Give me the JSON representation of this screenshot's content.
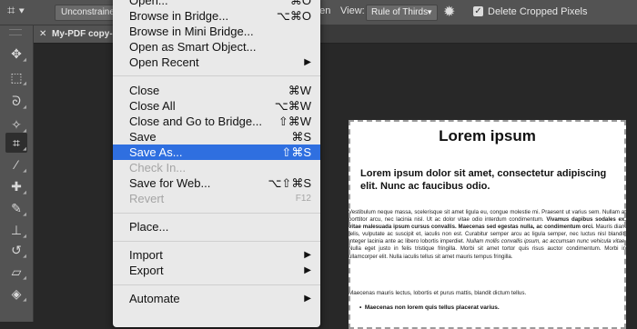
{
  "options_bar": {
    "crop_icon": "crop-icon",
    "ratio_label": "Unconstrained",
    "partial_label": "hten",
    "view_label": "View:",
    "view_value": "Rule of Thirds",
    "gear_icon": "gear-icon",
    "delete_checked": true,
    "delete_label": "Delete Cropped Pixels"
  },
  "tab": {
    "title": "My-PDF copy-",
    "close_icon": "close-icon"
  },
  "tools": [
    {
      "name": "move-tool-icon",
      "glyph": "✥"
    },
    {
      "name": "marquee-tool-icon",
      "glyph": "⬚"
    },
    {
      "name": "lasso-tool-icon",
      "glyph": "ᘐ"
    },
    {
      "name": "magic-wand-icon",
      "glyph": "✧"
    },
    {
      "name": "crop-tool-icon",
      "glyph": "⌗",
      "active": true
    },
    {
      "name": "eyedropper-icon",
      "glyph": "⁄"
    },
    {
      "name": "healing-brush-icon",
      "glyph": "✚"
    },
    {
      "name": "brush-tool-icon",
      "glyph": "✎"
    },
    {
      "name": "clone-stamp-icon",
      "glyph": "⊥"
    },
    {
      "name": "history-brush-icon",
      "glyph": "↺"
    },
    {
      "name": "eraser-tool-icon",
      "glyph": "▱"
    },
    {
      "name": "paint-bucket-icon",
      "glyph": "◈"
    }
  ],
  "menu": {
    "items": [
      {
        "label": "Open...",
        "shortcut": "⌘O"
      },
      {
        "label": "Browse in Bridge...",
        "shortcut": "⌥⌘O"
      },
      {
        "label": "Browse in Mini Bridge...",
        "shortcut": ""
      },
      {
        "label": "Open as Smart Object...",
        "shortcut": ""
      },
      {
        "label": "Open Recent",
        "submenu": true
      },
      {
        "label": "Close",
        "shortcut": "⌘W"
      },
      {
        "label": "Close All",
        "shortcut": "⌥⌘W"
      },
      {
        "label": "Close and Go to Bridge...",
        "shortcut": "⇧⌘W"
      },
      {
        "label": "Save",
        "shortcut": "⌘S"
      },
      {
        "label": "Save As...",
        "shortcut": "⇧⌘S",
        "selected": true
      },
      {
        "label": "Check In...",
        "disabled": true
      },
      {
        "label": "Save for Web...",
        "shortcut": "⌥⇧⌘S"
      },
      {
        "label": "Revert",
        "shortcut": "F12",
        "disabled": true
      },
      {
        "label": "Place..."
      },
      {
        "label": "Import",
        "submenu": true
      },
      {
        "label": "Export",
        "submenu": true
      },
      {
        "label": "Automate",
        "submenu": true
      }
    ]
  },
  "document": {
    "title": "Lorem ipsum",
    "subtitle": "Lorem ipsum dolor sit amet, consectetur adipiscing elit. Nunc ac faucibus odio.",
    "body_1": "Vestibulum neque massa, scelerisque sit amet ligula eu, congue molestie mi. Praesent ut varius sem. Nullam at porttitor arcu, nec lacinia nisl. Ut ac dolor vitae odio interdum condimentum. ",
    "body_bold": "Vivamus dapibus sodales ex, vitae malesuada ipsum cursus convallis. Maecenas sed egestas nulla, ac condimentum orci.",
    "body_2": " Mauris diam felis, vulputate ac suscipit et, iaculis non est. Curabitur semper arcu ac ligula semper, nec luctus nisl blandit. Integer lacinia ante ac libero lobortis imperdiet. ",
    "body_italic": "Nullam mollis convallis ipsum, ac accumsan nunc vehicula vitae.",
    "body_3": " Nulla eget justo in felis tristique fringilla. Morbi sit amet tortor quis risus auctor condimentum. Morbi in ullamcorper elit. Nulla iaculis tellus sit amet mauris tempus fringilla.",
    "para_2": "Maecenas mauris lectus, lobortis et purus mattis, blandit dictum tellus.",
    "bullet": "Maecenas non lorem quis tellus placerat varius."
  }
}
